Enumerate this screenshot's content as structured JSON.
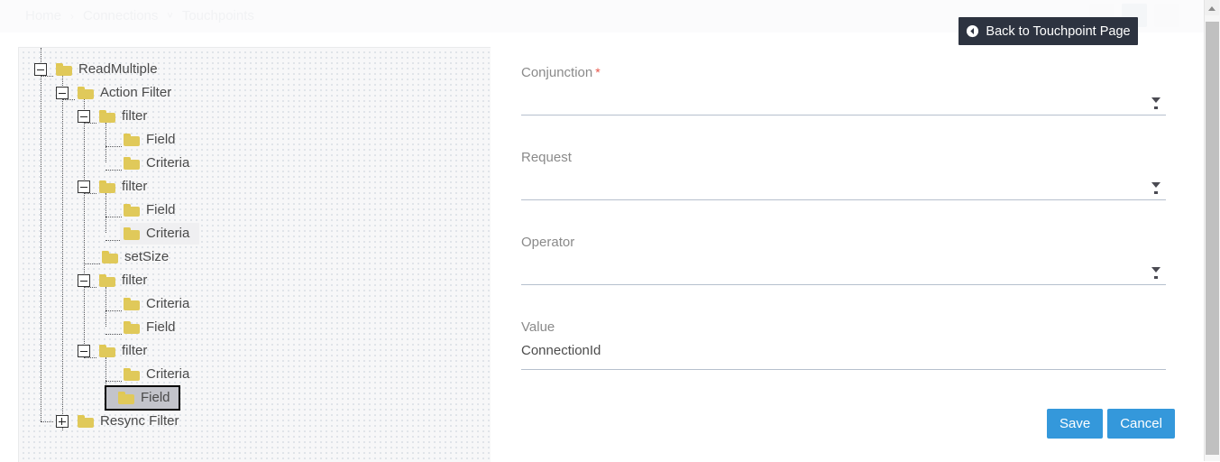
{
  "breadcrumb": {
    "items": [
      {
        "label": "Home"
      },
      {
        "label": "Connections"
      },
      {
        "label": "Touchpoints"
      }
    ],
    "separator": "›",
    "caret": "˅"
  },
  "back_button": {
    "label": "Back to Touchpoint Page",
    "icon": "arrow-circle-left-icon",
    "background": "#2d3340",
    "text_color": "#ffffff"
  },
  "tree": {
    "nodes": [
      {
        "id": "readmultiple",
        "label": "ReadMultiple",
        "depth": 0,
        "expander": "minus",
        "state": "normal"
      },
      {
        "id": "action-filter",
        "label": "Action Filter",
        "depth": 1,
        "expander": "minus",
        "state": "normal"
      },
      {
        "id": "filter-1",
        "label": "filter",
        "depth": 2,
        "expander": "minus",
        "state": "normal"
      },
      {
        "id": "field-1",
        "label": "Field",
        "depth": 3,
        "expander": "none",
        "state": "normal"
      },
      {
        "id": "criteria-1",
        "label": "Criteria",
        "depth": 3,
        "expander": "none",
        "state": "normal"
      },
      {
        "id": "filter-2",
        "label": "filter",
        "depth": 2,
        "expander": "minus",
        "state": "normal"
      },
      {
        "id": "field-2",
        "label": "Field",
        "depth": 3,
        "expander": "none",
        "state": "normal"
      },
      {
        "id": "criteria-2",
        "label": "Criteria",
        "depth": 3,
        "expander": "none",
        "state": "hover"
      },
      {
        "id": "setsize",
        "label": "setSize",
        "depth": 2,
        "expander": "none",
        "state": "normal"
      },
      {
        "id": "filter-3",
        "label": "filter",
        "depth": 2,
        "expander": "minus",
        "state": "normal"
      },
      {
        "id": "criteria-3",
        "label": "Criteria",
        "depth": 3,
        "expander": "none",
        "state": "normal"
      },
      {
        "id": "field-3",
        "label": "Field",
        "depth": 3,
        "expander": "none",
        "state": "normal"
      },
      {
        "id": "filter-4",
        "label": "filter",
        "depth": 2,
        "expander": "minus",
        "state": "normal"
      },
      {
        "id": "criteria-4",
        "label": "Criteria",
        "depth": 3,
        "expander": "none",
        "state": "normal"
      },
      {
        "id": "field-4",
        "label": "Field",
        "depth": 3,
        "expander": "none",
        "state": "selected"
      },
      {
        "id": "resync-filter",
        "label": "Resync Filter",
        "depth": 1,
        "expander": "plus",
        "state": "normal"
      }
    ],
    "folder_color": "#e0c95a",
    "selected_background": "#c3c4cb"
  },
  "form": {
    "fields": [
      {
        "id": "conjunction",
        "label": "Conjunction",
        "required": true,
        "type": "select",
        "value": "",
        "placeholder": ""
      },
      {
        "id": "request",
        "label": "Request",
        "required": false,
        "type": "select",
        "value": "",
        "placeholder": ""
      },
      {
        "id": "operator",
        "label": "Operator",
        "required": false,
        "type": "select",
        "value": "",
        "placeholder": ""
      },
      {
        "id": "value",
        "label": "Value",
        "required": false,
        "type": "text",
        "value": "ConnectionId",
        "placeholder": ""
      }
    ],
    "required_marker": "*",
    "buttons": {
      "save": "Save",
      "cancel": "Cancel",
      "accent_color": "#3498db"
    }
  },
  "scrollbar": {
    "up_arrow": "scroll-up-arrow-icon",
    "thumb": "scroll-thumb"
  }
}
